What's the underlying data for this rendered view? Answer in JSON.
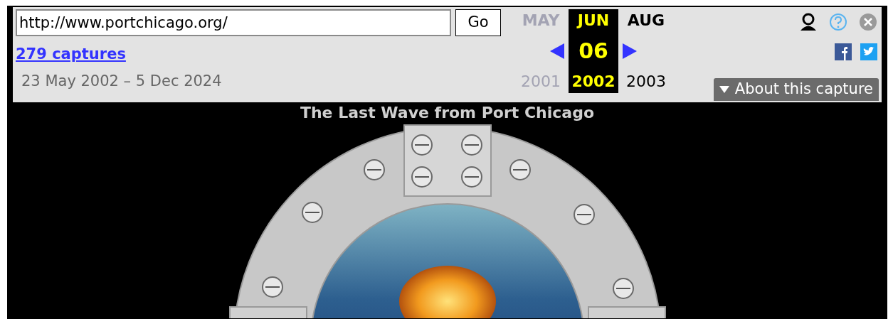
{
  "toolbar": {
    "url_field": {
      "value": "http://www.portchicago.org/"
    },
    "go_button": "Go",
    "captures_link": "279 captures",
    "date_range": "23 May 2002 – 5 Dec 2024",
    "columns": [
      {
        "month": "MAY",
        "year": "2001",
        "selected": false,
        "disabled": true
      },
      {
        "month": "JUN",
        "day": "06",
        "year": "2002",
        "selected": true,
        "disabled": false
      },
      {
        "month": "AUG",
        "year": "2003",
        "selected": false,
        "disabled": false
      }
    ],
    "about_button": "About this capture"
  },
  "page": {
    "title": "The Last Wave from Port Chicago"
  }
}
